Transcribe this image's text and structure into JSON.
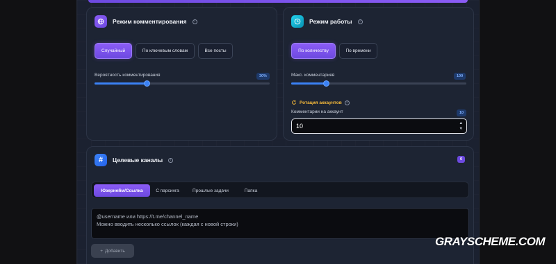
{
  "comment_mode": {
    "title": "Режим комментирования",
    "buttons": [
      "Случайный",
      "По ключевым словам",
      "Все посты"
    ],
    "active_button": 0,
    "probability_label": "Вероятность комментирования",
    "probability_value": "30%",
    "probability_fraction": 0.3
  },
  "work_mode": {
    "title": "Режим работы",
    "buttons": [
      "По количеству",
      "По времени"
    ],
    "active_button": 0,
    "max_comments_label": "Макс. комментариев",
    "max_comments_value": "100",
    "max_comments_fraction": 0.2,
    "rotation_label": "Ротация аккаунтов",
    "per_account_label": "Комментарии на аккаунт",
    "per_account_badge": "10",
    "per_account_value": "10"
  },
  "target_channels": {
    "title": "Целевые каналы",
    "count": "0",
    "tabs": [
      "Юзернейм/Ссылка",
      "С парсинга",
      "Прошлые задачи",
      "Папка"
    ],
    "active_tab": 0,
    "textarea_placeholder": "@username или https://t.me/channel_name\nМожно вводить несколько ссылок (каждая с новой строки)",
    "add_label": "Добавить"
  },
  "watermark": "GRAYSCHEME.COM",
  "colors": {
    "accent_purple": "#8b5cf6",
    "accent_blue": "#3b82f6",
    "rotation_orange": "#f5b93a",
    "card_bg": "#1d2433"
  },
  "icons": {
    "comment_mode": "globe-icon",
    "work_mode": "clock-icon",
    "target_channels": "hash-icon",
    "rotation": "refresh-icon"
  }
}
